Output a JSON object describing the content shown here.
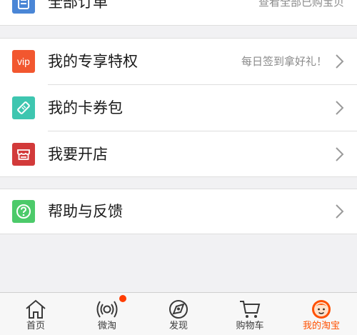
{
  "orders_row": {
    "label": "全部订单",
    "hint": "查看全部已购宝贝"
  },
  "menu_group": [
    {
      "label": "我的专享特权",
      "hint": "每日签到拿好礼！",
      "icon": "vip-icon",
      "icon_text": "vip",
      "color": "#f2572f"
    },
    {
      "label": "我的卡券包",
      "hint": "",
      "icon": "coupon-icon",
      "color": "#3ec6b0"
    },
    {
      "label": "我要开店",
      "hint": "",
      "icon": "shop-icon",
      "color": "#d23a3a"
    }
  ],
  "help_row": {
    "label": "帮助与反馈",
    "icon": "help-icon",
    "color": "#4cca6a"
  },
  "tabbar": [
    {
      "label": "首页",
      "icon": "home-icon"
    },
    {
      "label": "微淘",
      "icon": "broadcast-icon"
    },
    {
      "label": "发现",
      "icon": "discover-icon"
    },
    {
      "label": "购物车",
      "icon": "cart-icon"
    },
    {
      "label": "我的淘宝",
      "icon": "my-taobao-icon",
      "active": true
    }
  ],
  "colors": {
    "accent": "#ff5000",
    "background": "#f1f1f3",
    "order_icon": "#4a86d6"
  }
}
